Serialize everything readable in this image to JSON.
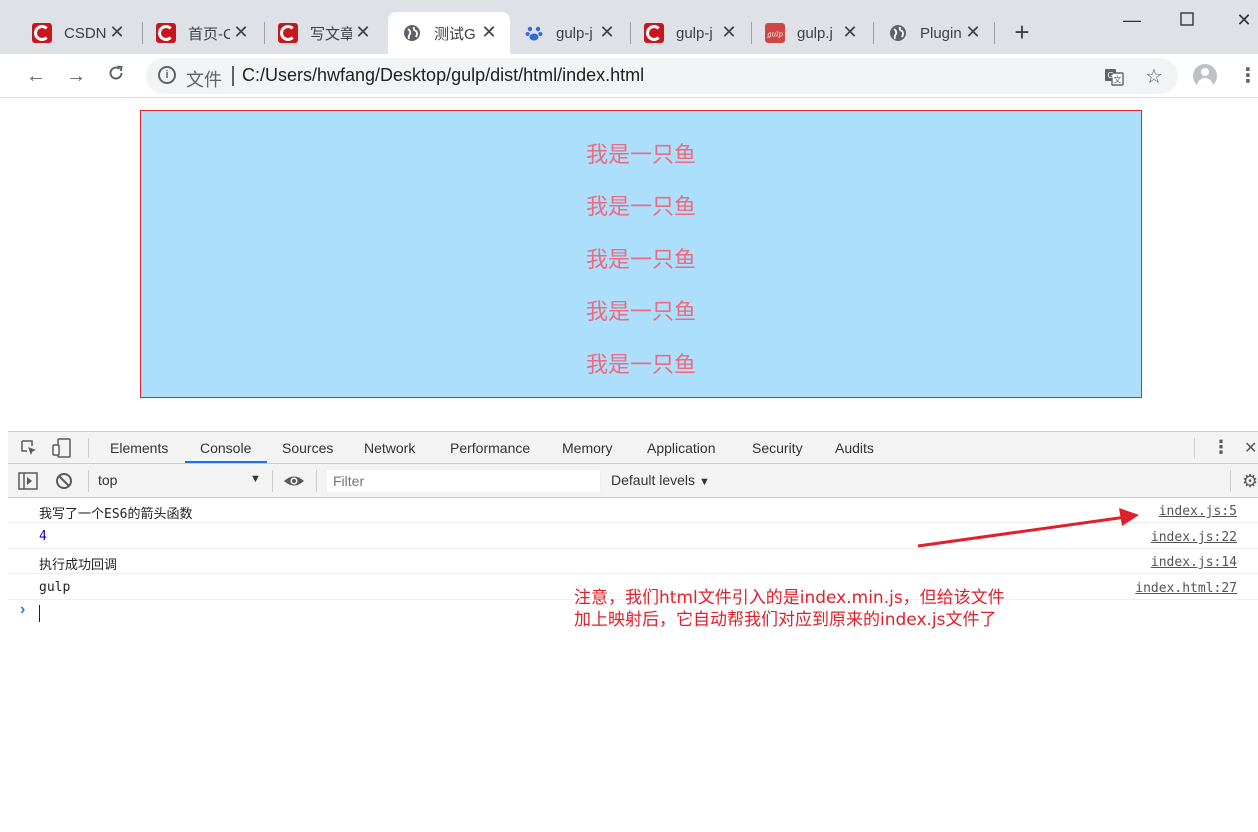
{
  "browser": {
    "tabs": [
      {
        "title": "CSDN",
        "icon": "csdn-icon",
        "active": false
      },
      {
        "title": "首页-C",
        "icon": "csdn-icon",
        "active": false
      },
      {
        "title": "写文章",
        "icon": "csdn-icon",
        "active": false
      },
      {
        "title": "测试G",
        "icon": "globe-icon",
        "active": true
      },
      {
        "title": "gulp-j",
        "icon": "baidu-paw-icon",
        "active": false
      },
      {
        "title": "gulp-j",
        "icon": "csdn-icon",
        "active": false
      },
      {
        "title": "gulp.j",
        "icon": "gulp-icon",
        "active": false
      },
      {
        "title": "Plugin",
        "icon": "globe-icon",
        "active": false
      }
    ],
    "omnibox": {
      "label": "文件",
      "url": "C:/Users/hwfang/Desktop/gulp/dist/html/index.html"
    }
  },
  "page": {
    "lines": [
      "我是一只鱼",
      "我是一只鱼",
      "我是一只鱼",
      "我是一只鱼",
      "我是一只鱼"
    ],
    "colors": {
      "box_bg": "#abdffc",
      "box_border": "#e0252f",
      "text": "#ee6a7f"
    }
  },
  "devtools": {
    "tabs": [
      "Elements",
      "Console",
      "Sources",
      "Network",
      "Performance",
      "Memory",
      "Application",
      "Security",
      "Audits"
    ],
    "active_tab": "Console",
    "context": "top",
    "filter_placeholder": "Filter",
    "levels": "Default levels",
    "logs": [
      {
        "message": "我写了一个ES6的箭头函数",
        "source": "index.js:5"
      },
      {
        "message": "4",
        "source": "index.js:22"
      },
      {
        "message": "执行成功回调",
        "source": "index.js:14"
      },
      {
        "message": "gulp",
        "source": "index.html:27"
      }
    ]
  },
  "annotation": {
    "line1": "注意，我们html文件引入的是index.min.js，但给该文件",
    "line2": "加上映射后，它自动帮我们对应到原来的index.js文件了",
    "color": "#e0202a"
  }
}
